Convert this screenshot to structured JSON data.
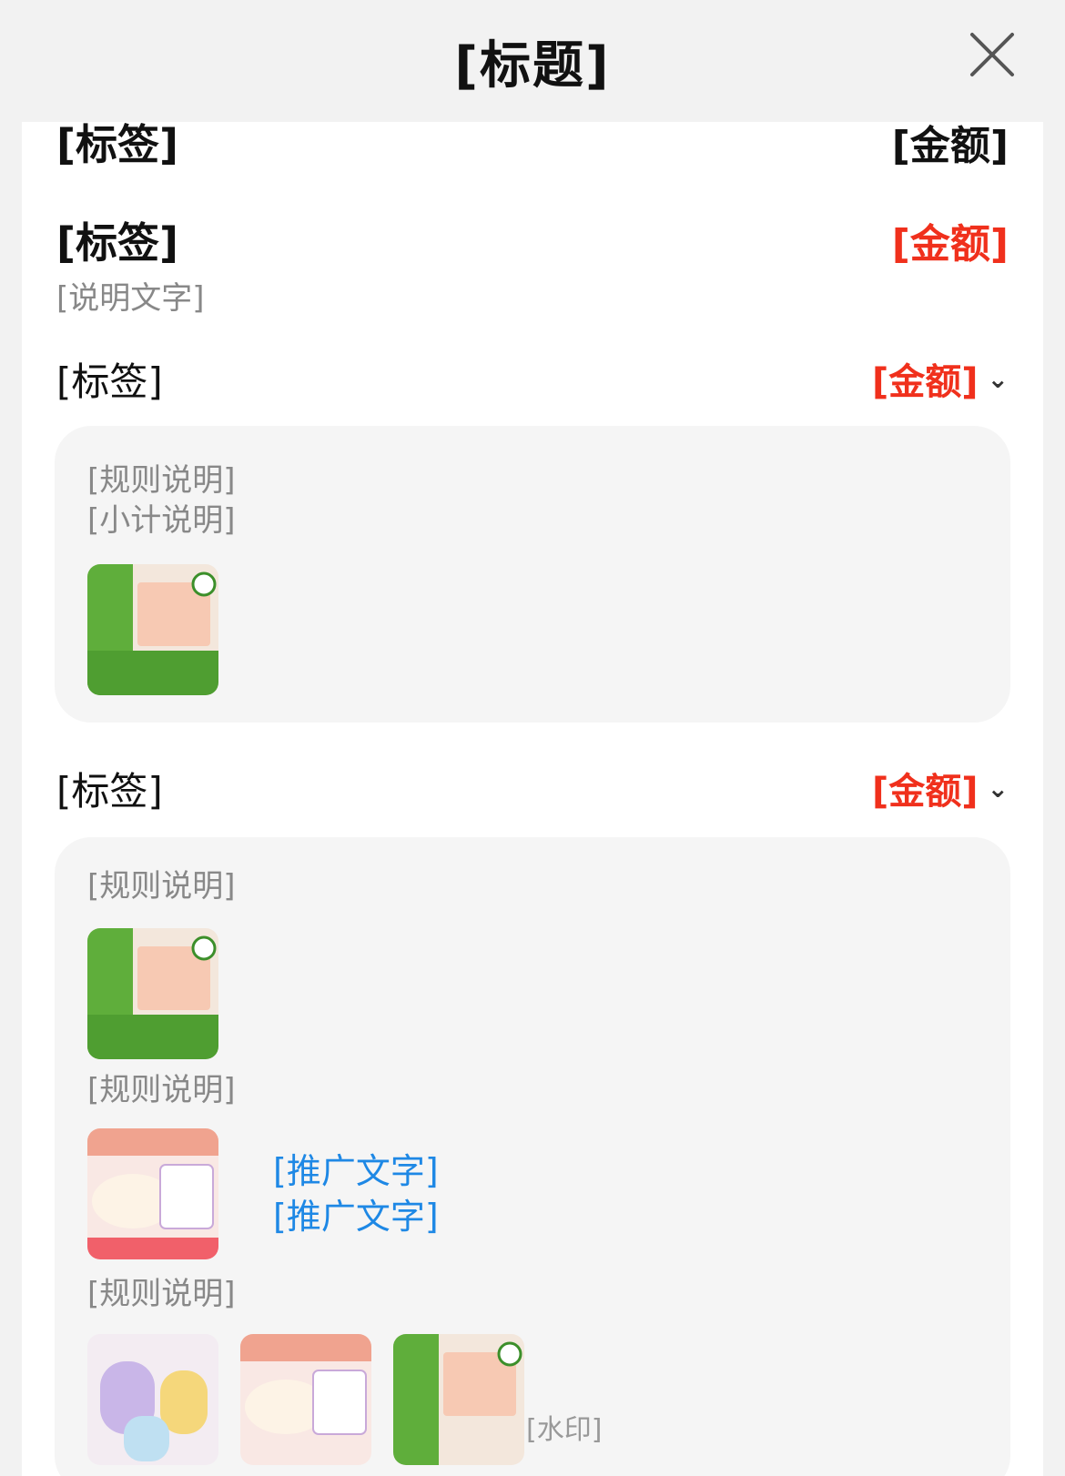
{
  "header": {
    "title": "[标题]"
  },
  "summary": {
    "total_label": "[标签]",
    "total_value": "[金额]",
    "discount_label": "[标签]",
    "discount_value": "[金额]",
    "note": "[说明文字]"
  },
  "promotion": {
    "label": "[标签]",
    "value": "[金额]",
    "rule_line1": "[规则说明]",
    "rule_line2": "[小计说明]"
  },
  "coupon": {
    "label": "[标签]",
    "value": "[金额]",
    "rule1": "[规则说明]",
    "rule2": "[规则说明]",
    "promo_line1": "[推广文字]",
    "promo_line2": "[推广文字]",
    "rule3": "[规则说明]"
  },
  "watermark": "[水印]",
  "colors": {
    "accent_red": "#f0301c",
    "promo_blue": "#1e88e5"
  },
  "icons": [
    "close-icon",
    "chevron-down-icon",
    "product-thumbnail",
    "weibo-icon"
  ]
}
